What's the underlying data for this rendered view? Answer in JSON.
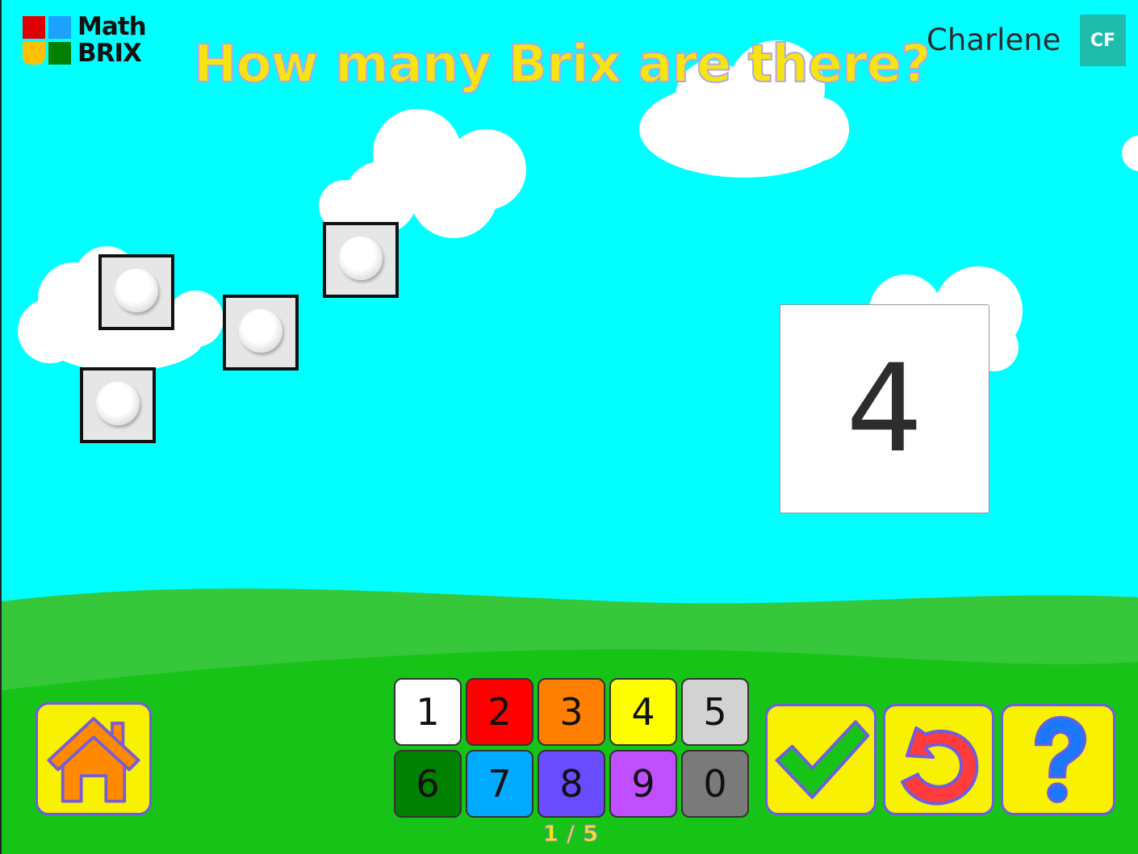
{
  "logo": {
    "line1": "Math",
    "line2": "BRIX",
    "colors": [
      "#e00000",
      "#1ea0ff",
      "#ffc000",
      "#008000"
    ]
  },
  "header": {
    "title": "How many Brix are there?"
  },
  "user": {
    "name": "Charlene",
    "initials": "CF",
    "avatar_color": "#1fbcac"
  },
  "game": {
    "brick_count": 4,
    "answer": "4",
    "progress": "1 / 5"
  },
  "keypad": {
    "keys": [
      {
        "label": "1",
        "color": "#ffffff"
      },
      {
        "label": "2",
        "color": "#ff0000"
      },
      {
        "label": "3",
        "color": "#ff8000"
      },
      {
        "label": "4",
        "color": "#ffff00"
      },
      {
        "label": "5",
        "color": "#d2d2d2"
      },
      {
        "label": "6",
        "color": "#008000"
      },
      {
        "label": "7",
        "color": "#00aaff"
      },
      {
        "label": "8",
        "color": "#6a4cff"
      },
      {
        "label": "9",
        "color": "#c050ff"
      },
      {
        "label": "0",
        "color": "#7a7a7a"
      }
    ]
  },
  "buttons": {
    "home": "house-icon",
    "check": "checkmark-icon",
    "undo": "undo-icon",
    "help": "question-mark-icon"
  }
}
